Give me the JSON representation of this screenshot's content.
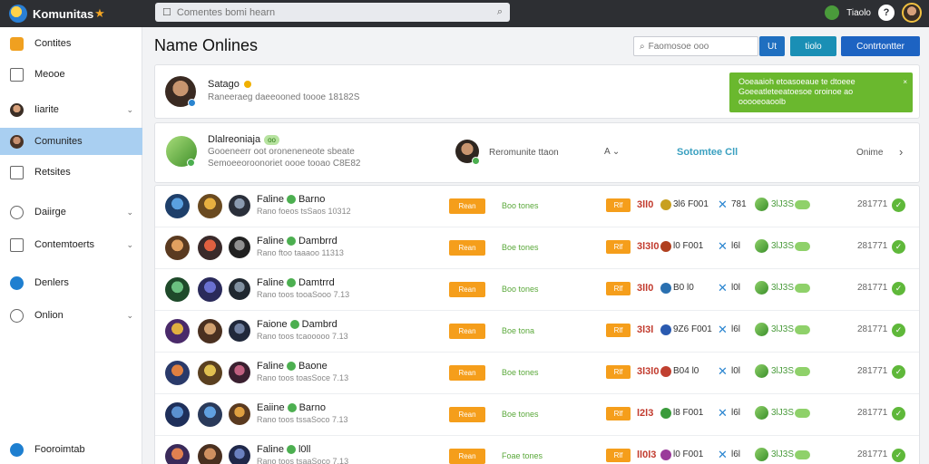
{
  "app": {
    "brand": "Komunitas",
    "brand_star": "★"
  },
  "search": {
    "placeholder": "Comentes bomi hearn"
  },
  "topbar": {
    "user_label": "Tiaolo",
    "help": "?"
  },
  "sidebar": {
    "items": [
      {
        "label": "Contites",
        "icon": "lock-icon",
        "color": "#f0a020",
        "chevron": false
      },
      {
        "label": "Meooe",
        "icon": "square-icon",
        "color": "#666666",
        "chevron": false
      },
      {
        "label": "Iiarite",
        "icon": "avatar-icon",
        "color": "#7a5035",
        "chevron": true
      },
      {
        "label": "Comunites",
        "icon": "avatar-icon",
        "color": "#6a4a35",
        "chevron": false,
        "active": true
      },
      {
        "label": "Retsites",
        "icon": "square-icon",
        "color": "#666666",
        "chevron": false
      },
      {
        "label": "Daiirge",
        "icon": "ring-icon",
        "color": "#666666",
        "chevron": true
      },
      {
        "label": "Contemtoerts",
        "icon": "square-icon",
        "color": "#666666",
        "chevron": true
      },
      {
        "label": "Denlers",
        "icon": "info-icon",
        "color": "#1e7fd0",
        "chevron": false
      },
      {
        "label": "Onlion",
        "icon": "ring-icon",
        "color": "#666666",
        "chevron": true
      }
    ],
    "footer": {
      "label": "Fooroimtab",
      "color": "#1e7fd0"
    }
  },
  "main": {
    "title": "Name Onlines",
    "filter_placeholder": "Faomosoe ooo",
    "buttons": {
      "a": "Ut",
      "b": "tiolo",
      "c": "Contrtontter"
    }
  },
  "profile": {
    "name": "Satago",
    "subtitle": "Raneeraeg daeeooned toooe 18182S",
    "notice_lines": [
      "Ooeaaioh etoasoeaue te dtoeee",
      "Goeeatleteeatoesoe oroinoe ao",
      "ooooeoaoolb"
    ],
    "notice_close": "×"
  },
  "group": {
    "name": "Dlalreoniaja",
    "tag": "oo",
    "line1": "Gooeneerr oot oroneneneote sbeate",
    "line2": "Semoeeoroonoriet oooe tooao C8E82",
    "member_name": "Reromunite ttaon",
    "sort_label": "A",
    "link": "Sotomtee Cll",
    "status": "Onime",
    "chevron": "›"
  },
  "rows": [
    {
      "name": "Faline",
      "name2": "Barno",
      "sub": "Rano foeos tsSaos 10312",
      "chip": "Rean",
      "status": "Boo tones",
      "c2": "Rlf",
      "stat1": "3ll0",
      "stat2": "3l6  F001",
      "stat3": "781",
      "stat4": "3lJ3S",
      "count": "281771"
    },
    {
      "name": "Faline",
      "name2": "Dambrrd",
      "sub": "Rano ftoo taaaoo 11313",
      "chip": "Rean",
      "status": "Boe tones",
      "c2": "Rlf",
      "stat1": "3l3l0",
      "stat2": "l0  F001",
      "stat3": "l6l",
      "stat4": "3lJ3S",
      "count": "281771"
    },
    {
      "name": "Faline",
      "name2": "Damtrrd",
      "sub": "Rano toos tooaSooo 7.13",
      "chip": "Rean",
      "status": "Boo tones",
      "c2": "Rlf",
      "stat1": "3ll0",
      "stat2": "B0 l0",
      "stat3": "l0l",
      "stat4": "3lJ3S",
      "count": "281771"
    },
    {
      "name": "Faione",
      "name2": "Dambrd",
      "sub": "Rano toos tcaooooo 7.13",
      "chip": "Rean",
      "status": "Boe tona",
      "c2": "Rlf",
      "stat1": "3l3l",
      "stat2": "9Z6  F001",
      "stat3": "l6l",
      "stat4": "3lJ3S",
      "count": "281771"
    },
    {
      "name": "Faline",
      "name2": "Baone",
      "sub": "Rano toos toasSoce 7.13",
      "chip": "Rean",
      "status": "Boe tones",
      "c2": "Rlf",
      "stat1": "3l3l0",
      "stat2": "B04  l0",
      "stat3": "l0l",
      "stat4": "3lJ3S",
      "count": "281771"
    },
    {
      "name": "Eaiine",
      "name2": "Barno",
      "sub": "Rano toos tssaSoco 7.13",
      "chip": "Rean",
      "status": "Boe tones",
      "c2": "Rlf",
      "stat1": "l2l3",
      "stat2": "l8  F001",
      "stat3": "l6l",
      "stat4": "3lJ3S",
      "count": "281771"
    },
    {
      "name": "Faline",
      "name2": "l0ll",
      "sub": "Rano toos tsaaSoco 7.13",
      "chip": "Rean",
      "status": "Foae tones",
      "c2": "Rlf",
      "stat1": "ll0l3",
      "stat2": "l0  F001",
      "stat3": "l6l",
      "stat4": "3lJ3S",
      "count": "281771"
    }
  ]
}
